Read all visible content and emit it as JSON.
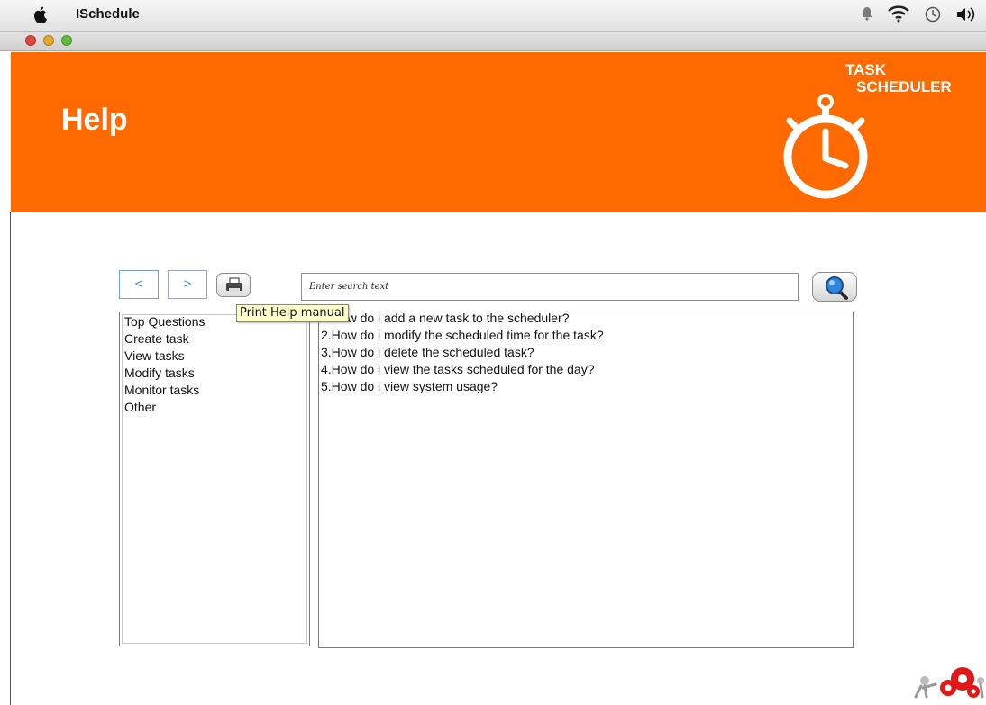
{
  "menubar": {
    "app_name": "ISchedule",
    "icons": [
      "apple-icon",
      "bell-icon",
      "wifi-icon",
      "time-machine-icon",
      "volume-icon"
    ]
  },
  "header": {
    "title": "Help",
    "logo_line1": "TASK",
    "logo_line2": "SCHEDULER",
    "color": "#ff6a00"
  },
  "toolbar": {
    "back_label": "<",
    "forward_label": ">",
    "print_icon": "printer-icon",
    "search_placeholder": "Enter search text",
    "search_icon": "magnifier-icon"
  },
  "tooltip": {
    "text": "Print Help manual"
  },
  "categories": [
    {
      "label": "Top Questions"
    },
    {
      "label": "Create task"
    },
    {
      "label": "View tasks"
    },
    {
      "label": "Modify tasks"
    },
    {
      "label": "Monitor tasks"
    },
    {
      "label": "Other"
    }
  ],
  "questions": [
    {
      "label": "1.How do i add a new task to the scheduler?"
    },
    {
      "label": "2.How do i modify the scheduled time for the task?"
    },
    {
      "label": "3.How do i delete the scheduled task?"
    },
    {
      "label": "4.How do i view the tasks scheduled for the day?"
    },
    {
      "label": "5.How do i view system usage?"
    }
  ]
}
